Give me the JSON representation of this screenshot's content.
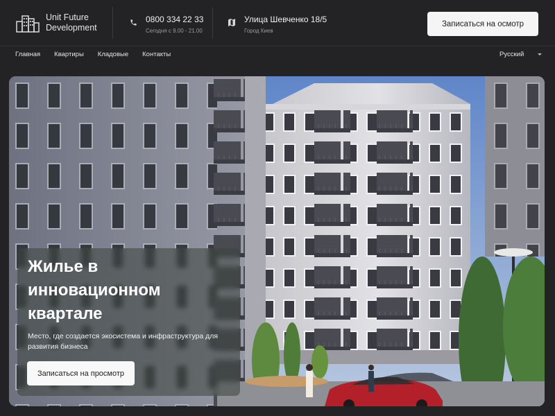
{
  "brand": {
    "line1": "Unit Future",
    "line2": "Development",
    "icon": "buildings-logo-icon"
  },
  "phone": {
    "number": "0800 334 22 33",
    "hours": "Сегодня с 9.00 - 21.00",
    "icon": "phone-icon"
  },
  "address": {
    "street": "Улица Шевченко 18/5",
    "city": "Город Киев",
    "icon": "map-icon"
  },
  "header": {
    "cta_label": "Записаться на осмотр"
  },
  "nav": {
    "items": [
      "Главная",
      "Квартиры",
      "Кладовые",
      "Контакты"
    ]
  },
  "language": {
    "selected": "Русский",
    "icon": "chevron-down-icon"
  },
  "hero": {
    "title": "Жилье в инновационном квартале",
    "subtitle": "Место, где создается экосистема и инфраструктура для развития бизнеса",
    "cta_label": "Записаться на просмотр"
  },
  "colors": {
    "background": "#232325",
    "button_bg": "#f5f5f5",
    "button_text": "#1f1f22",
    "muted": "#9a9a9e"
  }
}
